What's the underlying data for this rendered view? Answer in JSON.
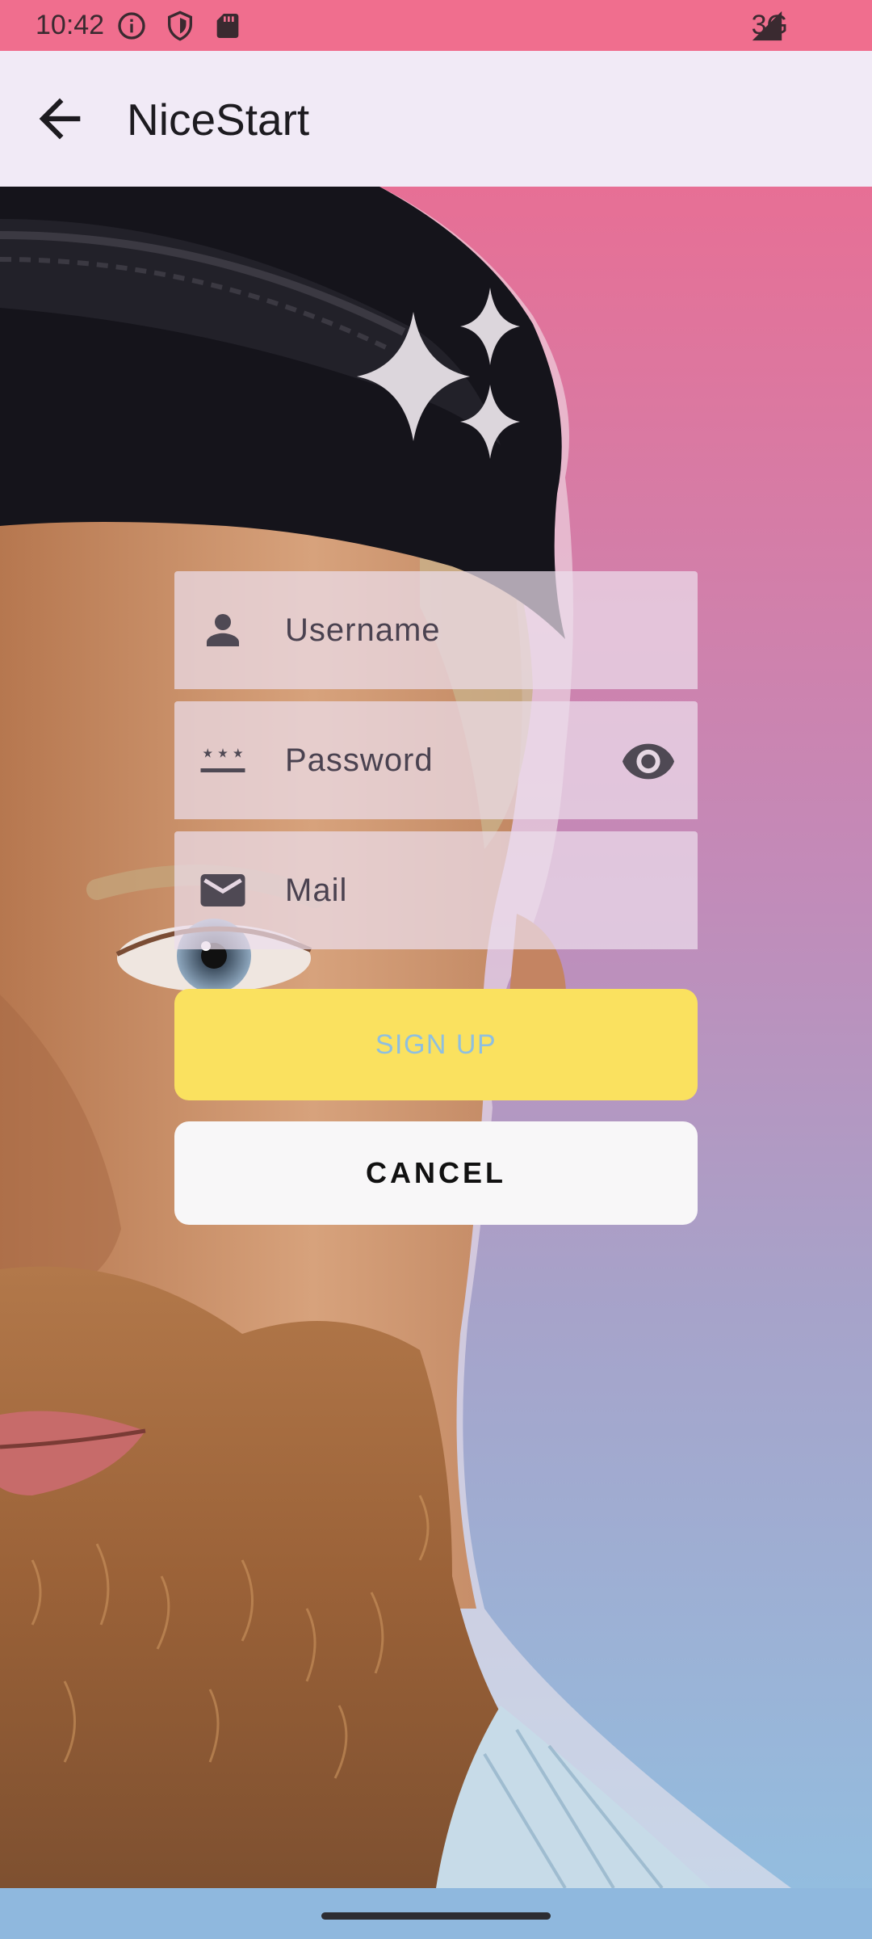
{
  "status_bar": {
    "time": "10:42",
    "network": "3G",
    "icons": [
      "info-icon",
      "shield-icon",
      "sd-card-icon",
      "signal-icon"
    ],
    "background": "#f06e8e"
  },
  "app_bar": {
    "title": "NiceStart",
    "back_icon": "arrow-back-icon",
    "background": "#f1eaf6"
  },
  "form": {
    "username": {
      "placeholder": "Username",
      "value": "",
      "icon": "person-icon"
    },
    "password": {
      "placeholder": "Password",
      "value": "",
      "icon": "password-icon",
      "toggle_icon": "eye-icon"
    },
    "mail": {
      "placeholder": "Mail",
      "value": "",
      "icon": "mail-icon"
    }
  },
  "buttons": {
    "signup_label": "SIGN UP",
    "cancel_label": "CANCEL",
    "signup_color": "#fae15f",
    "cancel_color": "#f8f7f8"
  },
  "hero": {
    "decoration_icon": "sparkle-icon",
    "background_image": "bearded-man-portrait"
  }
}
